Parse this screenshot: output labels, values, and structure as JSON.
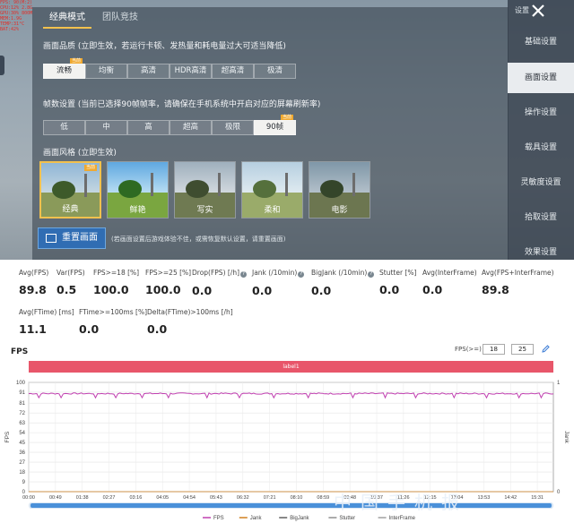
{
  "game": {
    "fps_overlay": [
      "FPS: 90(M:2)",
      "CPU:12% 2.8G",
      "GPU:30% 800M",
      "MEM:1.9G",
      "TEMP:31°C",
      "BAT:42%"
    ],
    "tabs": [
      "经典模式",
      "团队竞技"
    ],
    "quality_title": "画面品质 (立即生效，若运行卡顿、发热量和耗电量过大可适当降低)",
    "quality_options": [
      "流畅",
      "均衡",
      "高清",
      "HDR高清",
      "超高清",
      "极清"
    ],
    "frame_title": "帧数设置 (当前已选择90帧帧率，请确保在手机系统中开启对应的屏幕刷新率)",
    "frame_options": [
      "低",
      "中",
      "高",
      "超高",
      "极限",
      "90帧"
    ],
    "current_tag": "当前",
    "style_title": "画面风格 (立即生效)",
    "styles": [
      "经典",
      "鲜艳",
      "写实",
      "柔和",
      "电影"
    ],
    "reset_label": "重置画面",
    "reset_note": "(若画面设置后游戏体验不佳，或需恢复默认设置，请重置画面)",
    "side_title": "设置",
    "side_items": [
      "基础设置",
      "画面设置",
      "操作设置",
      "载具设置",
      "灵敏度设置",
      "拾取设置",
      "效果设置"
    ]
  },
  "stats": {
    "avg_fps": {
      "label": "Avg(FPS)",
      "value": "89.8"
    },
    "var_fps": {
      "label": "Var(FPS)",
      "value": "0.5"
    },
    "fps18": {
      "label": "FPS>=18 [%]",
      "value": "100.0"
    },
    "fps25": {
      "label": "FPS>=25 [%]",
      "value": "100.0"
    },
    "drop_fps": {
      "label": "Drop(FPS) [/h]",
      "value": "0.0"
    },
    "jank": {
      "label": "Jank (/10min)",
      "value": "0.0"
    },
    "bigjank": {
      "label": "BigJank (/10min)",
      "value": "0.0"
    },
    "stutter": {
      "label": "Stutter [%]",
      "value": "0.0"
    },
    "avg_inter": {
      "label": "Avg(InterFrame)",
      "value": "0.0"
    },
    "avg_fps_inter": {
      "label": "Avg(FPS+InterFrame)",
      "value": "89.8"
    },
    "avg_ftime": {
      "label": "Avg(FTime) [ms]",
      "value": "11.1"
    },
    "ftime100": {
      "label": "FTime>=100ms [%]",
      "value": "0.0"
    },
    "delta_ftime": {
      "label": "Delta(FTime)>100ms [/h]",
      "value": "0.0"
    }
  },
  "chart_ui": {
    "title": "FPS",
    "fps_threshold_label": "FPS(>=)",
    "threshold1": "18",
    "threshold2": "25",
    "label_bar": "label1"
  },
  "chart_data": {
    "type": "line",
    "ylabel": "FPS",
    "y2label": "Jank",
    "ylim": [
      0,
      100
    ],
    "yticks": [
      0,
      9,
      18,
      27,
      36,
      45,
      54,
      63,
      72,
      81,
      91,
      100
    ],
    "y2ticks": [
      0,
      1
    ],
    "xticks": [
      "00:00",
      "00:49",
      "01:38",
      "02:27",
      "03:16",
      "04:05",
      "04:54",
      "05:43",
      "06:32",
      "07:21",
      "08:10",
      "08:59",
      "09:48",
      "10:37",
      "11:26",
      "12:15",
      "13:04",
      "13:53",
      "14:42",
      "15:31"
    ],
    "x_end_seconds": 974,
    "legend": [
      "FPS",
      "Jank",
      "BigJank",
      "Stutter",
      "InterFrame"
    ],
    "legend_colors": [
      "#c040b0",
      "#d08020",
      "#606060",
      "#909090",
      "#a0a0a0"
    ],
    "series": [
      {
        "name": "FPS",
        "color": "#c040b0",
        "summary": {
          "baseline": 89.8,
          "min": 86,
          "max": 92
        },
        "dips_seconds": [
          18,
          60,
          125,
          160,
          210,
          260,
          330,
          390,
          455,
          520,
          600,
          660,
          720,
          790,
          850,
          910,
          950
        ]
      },
      {
        "name": "Jank",
        "color": "#d08020",
        "values_all": 0
      }
    ],
    "grid": true,
    "watermark": "中国手机报"
  }
}
